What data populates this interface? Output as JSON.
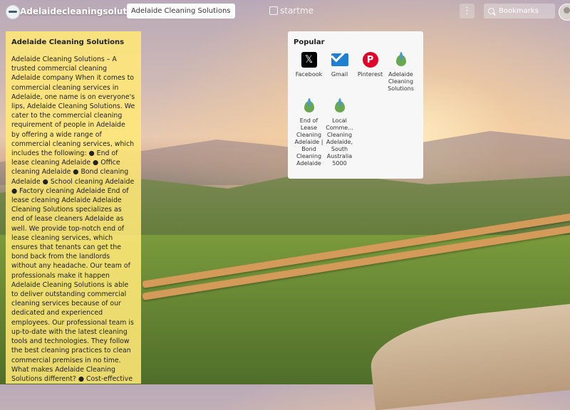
{
  "topbar": {
    "page_name": "Adelaidecleaningsolution",
    "active_tab": "Adelaide Cleaning Solutions",
    "brand": "startme",
    "search_placeholder": "Bookmarks",
    "menu_glyph": "⋮"
  },
  "note": {
    "title": "Adelaide Cleaning Solutions",
    "body": "Adelaide Cleaning Solutions – A trusted commercial cleaning Adelaide company When it comes to commercial cleaning services in Adelaide, one name is on everyone's lips, Adelaide Cleaning Solutions. We cater to the commercial cleaning requirement of people in Adelaide by offering a wide range of commercial cleaning services, which includes the following: ● End of lease cleaning Adelaide ● Office cleaning Adelaide ● Bond cleaning Adelaide ● School cleaning Adelaide ● Factory cleaning Adelaide End of lease cleaning Adelaide Adelaide Cleaning Solutions specializes as end of lease cleaners Adelaide as well. We provide top-notch end of lease cleaning services, which ensures that tenants can get the bond back from the landlords without any headache. Our team of professionals make it happen Adelaide Cleaning Solutions is able to deliver outstanding commercial cleaning services because of our dedicated and experienced employees. Our professional team is up-to-date with the latest cleaning tools and technologies. They follow the best cleaning practices to clean commercial premises in no time. What makes Adelaide Cleaning Solutions different? ● Cost-effective commercial cleaning services. ● Specialized techniques and equipment to get the"
  },
  "popular": {
    "title": "Popular",
    "items": [
      {
        "label": "Facebook",
        "icon": "x-icon",
        "glyph": "𝕏"
      },
      {
        "label": "Gmail",
        "icon": "gmail-icon",
        "glyph": ""
      },
      {
        "label": "Pinterest",
        "icon": "pinterest-icon",
        "glyph": "P"
      },
      {
        "label": "Adelaide Cleaning Solutions",
        "icon": "leaf-icon",
        "glyph": ""
      },
      {
        "label": "End of Lease Cleaning Adelaide | Bond Cleaning Adelaide",
        "icon": "leaf-icon",
        "glyph": ""
      },
      {
        "label": "Local Comme... Cleaning Adelaide, South Australia 5000",
        "icon": "leaf-icon",
        "glyph": ""
      }
    ]
  }
}
